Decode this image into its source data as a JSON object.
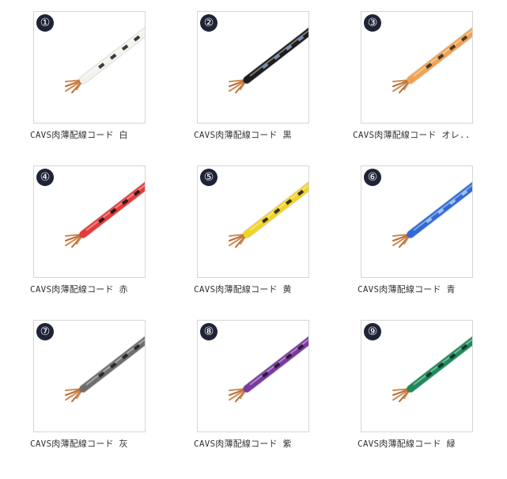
{
  "products": [
    {
      "badge": "①",
      "caption": "CAVS肉薄配線コード 白",
      "color": "#f4f2ec",
      "stripe": "#3a3a3a",
      "icon": "wire-white-icon"
    },
    {
      "badge": "②",
      "caption": "CAVS肉薄配線コード 黒",
      "color": "#1d1d1d",
      "stripe": "#7a8fb0",
      "icon": "wire-black-icon"
    },
    {
      "badge": "③",
      "caption": "CAVS肉薄配線コード オレ..",
      "color": "#f2a24e",
      "stripe": "#4a3a2a",
      "icon": "wire-orange-icon"
    },
    {
      "badge": "④",
      "caption": "CAVS肉薄配線コード 赤",
      "color": "#e63a3a",
      "stripe": "#2a1a1a",
      "icon": "wire-red-icon"
    },
    {
      "badge": "⑤",
      "caption": "CAVS肉薄配線コード 黄",
      "color": "#f2d324",
      "stripe": "#3a3420",
      "icon": "wire-yellow-icon"
    },
    {
      "badge": "⑥",
      "caption": "CAVS肉薄配線コード 青",
      "color": "#2f6ad8",
      "stripe": "#9fc0f0",
      "icon": "wire-blue-icon"
    },
    {
      "badge": "⑦",
      "caption": "CAVS肉薄配線コード 灰",
      "color": "#6e6e6e",
      "stripe": "#2a2a2a",
      "icon": "wire-gray-icon"
    },
    {
      "badge": "⑧",
      "caption": "CAVS肉薄配線コード 紫",
      "color": "#7b3aa0",
      "stripe": "#2a1a3a",
      "icon": "wire-purple-icon"
    },
    {
      "badge": "⑨",
      "caption": "CAVS肉薄配線コード 緑",
      "color": "#1e8a5c",
      "stripe": "#0e3a28",
      "icon": "wire-green-icon"
    }
  ]
}
